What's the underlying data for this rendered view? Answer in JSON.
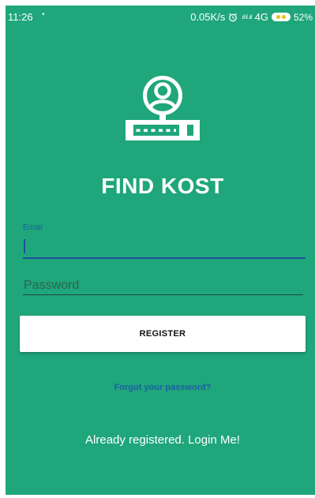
{
  "status_bar": {
    "time": "11:26",
    "dot": "•",
    "net_speed": "0.05K/s",
    "signal": ".ııl ıl .ııl",
    "network_type": "4G",
    "battery_percent": "52%"
  },
  "app": {
    "title": "FIND KOST",
    "logo_icon": "user-router-icon"
  },
  "login_form": {
    "email_label": "Email",
    "email_value": "",
    "password_placeholder": "Password",
    "password_value": "",
    "register_label": "REGISTER",
    "forgot_label": "Forgot your password?",
    "login_label": "Already registered. Login Me!"
  },
  "colors": {
    "background": "#1fa67b",
    "link": "#1d5fa6",
    "field_underline": "#1e4f9c",
    "button_bg": "#ffffff"
  }
}
